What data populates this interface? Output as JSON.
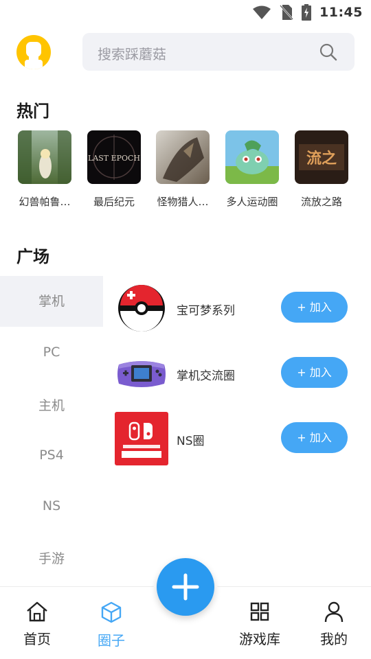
{
  "status_bar": {
    "time": "11:45"
  },
  "search": {
    "placeholder": "搜索踩蘑菇"
  },
  "sections": {
    "hot_title": "热门",
    "plaza_title": "广场"
  },
  "hot_items": [
    {
      "label": "幻兽帕鲁…"
    },
    {
      "label": "最后纪元"
    },
    {
      "label": "怪物猎人…"
    },
    {
      "label": "多人运动圈"
    },
    {
      "label": "流放之路"
    }
  ],
  "categories": [
    {
      "label": "掌机",
      "active": true
    },
    {
      "label": "PC"
    },
    {
      "label": "主机"
    },
    {
      "label": "PS4"
    },
    {
      "label": "NS"
    },
    {
      "label": "手游"
    }
  ],
  "circles": [
    {
      "name": "宝可梦系列",
      "join_label": "+ 加入",
      "icon": "pokeball-icon"
    },
    {
      "name": "掌机交流圈",
      "join_label": "+ 加入",
      "icon": "gameboy-advance-icon"
    },
    {
      "name": "NS圈",
      "join_label": "+ 加入",
      "icon": "nintendo-switch-icon"
    }
  ],
  "bottom_nav": [
    {
      "label": "首页",
      "icon": "home-icon"
    },
    {
      "label": "圈子",
      "icon": "cube-icon",
      "active": true
    },
    {
      "label": "游戏库",
      "icon": "grid-icon"
    },
    {
      "label": "我的",
      "icon": "user-icon"
    }
  ],
  "colors": {
    "accent": "#45a7f5",
    "fab": "#2a9af0",
    "avatar_bg": "#ffc400",
    "switch_red": "#e4252e"
  }
}
